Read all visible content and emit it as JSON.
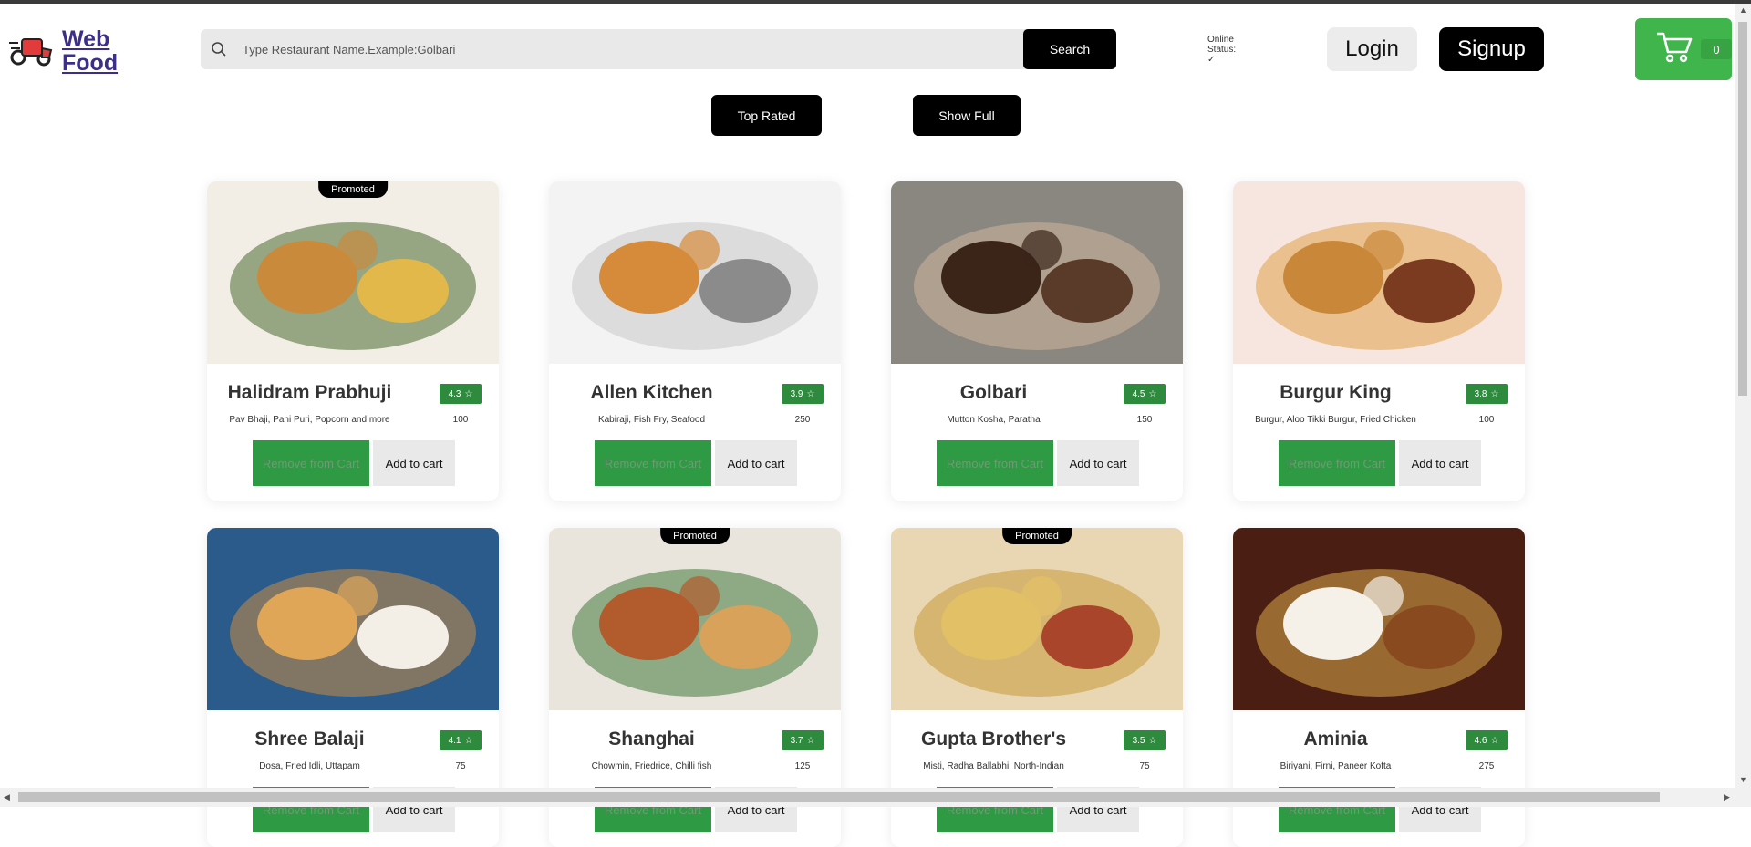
{
  "header": {
    "logo_line1": "Web",
    "logo_line2": "Food",
    "search_placeholder": "Type Restaurant Name.Example:Golbari",
    "search_button": "Search",
    "online_label_1": "Online",
    "online_label_2": "Status:",
    "online_value": "✓",
    "login": "Login",
    "signup": "Signup",
    "cart_count": "0"
  },
  "filters": {
    "top_rated": "Top Rated",
    "show_full": "Show Full"
  },
  "colors": {
    "accent_green": "#3fb54b",
    "rating_green": "#2e8b3e",
    "black": "#000000"
  },
  "restaurants": [
    {
      "name": "Halidram Prabhuji",
      "rating": "4.3",
      "cuisine": "Pav Bhaji, Pani Puri, Popcorn and more",
      "price": "100",
      "promoted": "Promoted",
      "remove": "Remove from Cart",
      "add": "Add to cart"
    },
    {
      "name": "Allen Kitchen",
      "rating": "3.9",
      "cuisine": "Kabiraji, Fish Fry, Seafood",
      "price": "250",
      "promoted": "",
      "remove": "Remove from Cart",
      "add": "Add to cart"
    },
    {
      "name": "Golbari",
      "rating": "4.5",
      "cuisine": "Mutton Kosha, Paratha",
      "price": "150",
      "promoted": "",
      "remove": "Remove from Cart",
      "add": "Add to cart"
    },
    {
      "name": "Burgur King",
      "rating": "3.8",
      "cuisine": "Burgur, Aloo Tikki Burgur, Fried Chicken",
      "price": "100",
      "promoted": "",
      "remove": "Remove from Cart",
      "add": "Add to cart"
    },
    {
      "name": "Shree Balaji",
      "rating": "4.1",
      "cuisine": "Dosa, Fried Idli, Uttapam",
      "price": "75",
      "promoted": "",
      "remove": "Remove from Cart",
      "add": "Add to cart"
    },
    {
      "name": "Shanghai",
      "rating": "3.7",
      "cuisine": "Chowmin, Friedrice, Chilli fish",
      "price": "125",
      "promoted": "Promoted",
      "remove": "Remove from Cart",
      "add": "Add to cart"
    },
    {
      "name": "Gupta Brother's",
      "rating": "3.5",
      "cuisine": "Misti, Radha Ballabhi, North-Indian",
      "price": "75",
      "promoted": "Promoted",
      "remove": "Remove from Cart",
      "add": "Add to cart"
    },
    {
      "name": "Aminia",
      "rating": "4.6",
      "cuisine": "Biriyani, Firni, Paneer Kofta",
      "price": "275",
      "promoted": "",
      "remove": "Remove from Cart",
      "add": "Add to cart"
    }
  ]
}
